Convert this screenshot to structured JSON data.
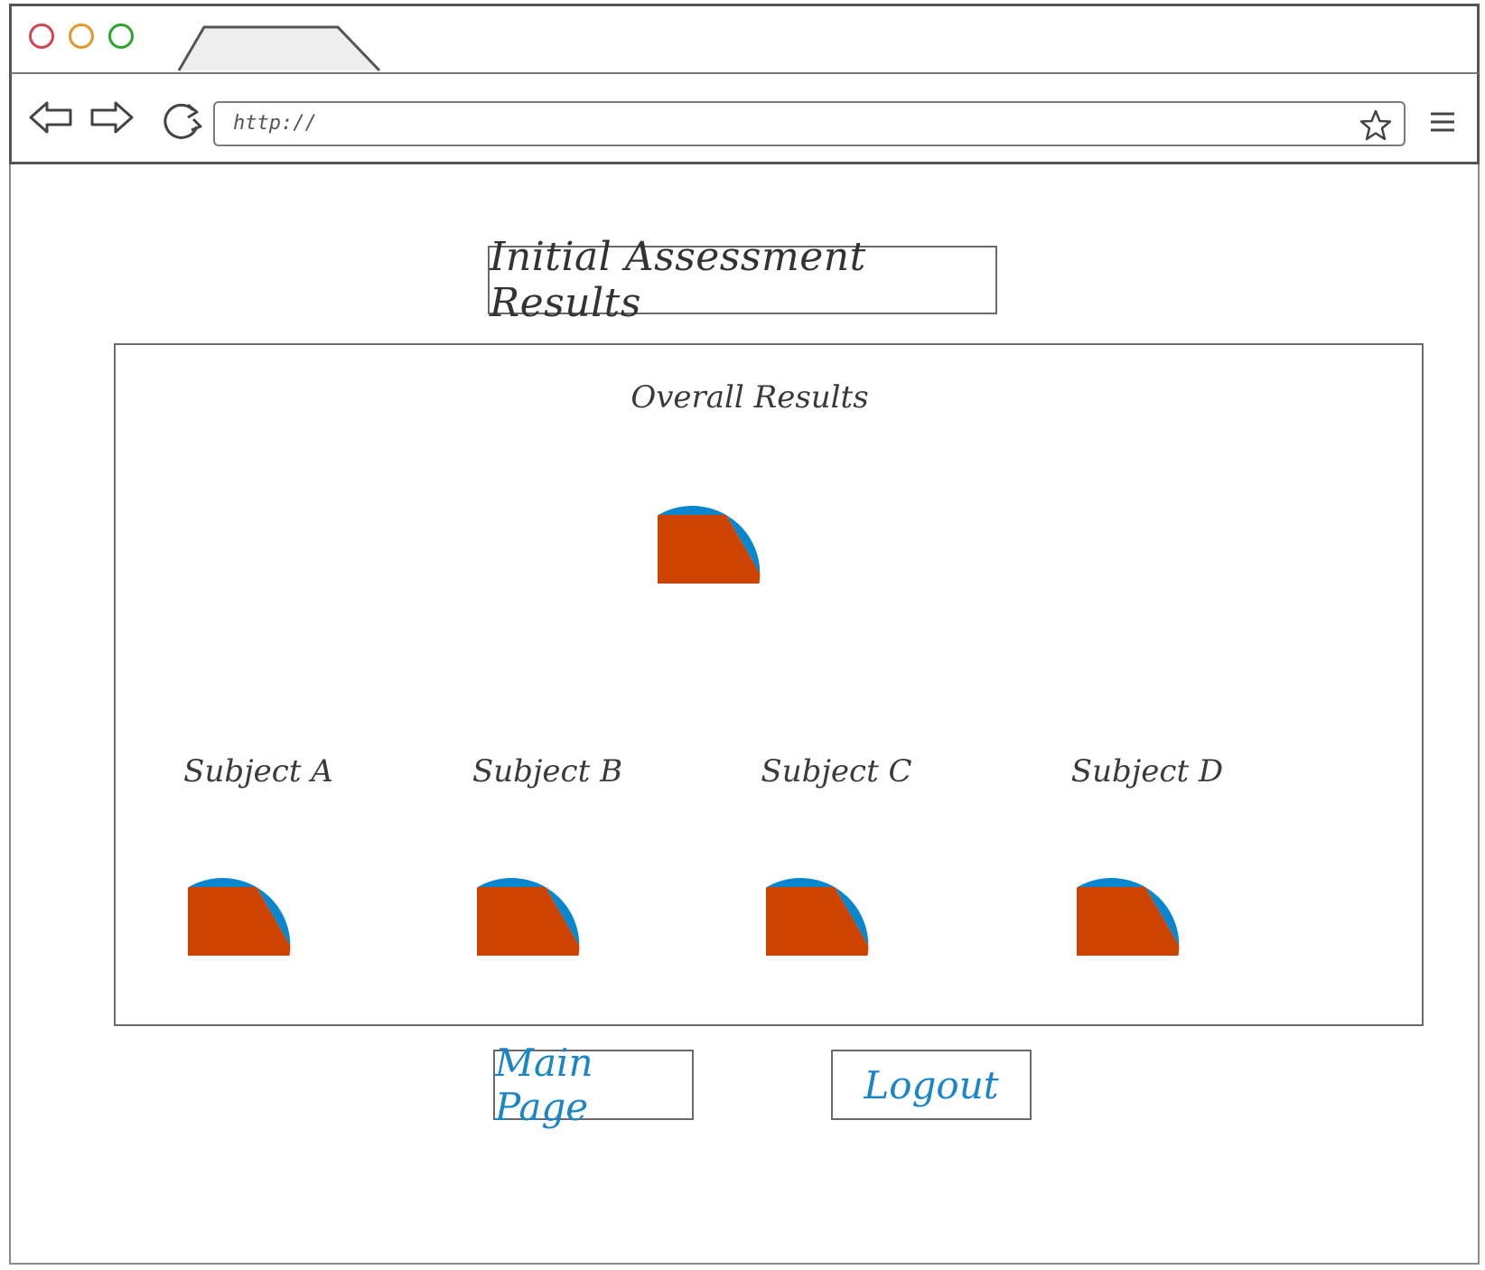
{
  "browser": {
    "url": "http://",
    "controls": {
      "close_color": "#d0454f",
      "minimize_color": "#e5962a",
      "maximize_color": "#2aa52a"
    }
  },
  "page": {
    "title": "Initial Assessment Results"
  },
  "chart_data": {
    "type": "pie",
    "colors": {
      "primary": "#cc4400",
      "secondary": "#0a86ce"
    },
    "charts": [
      {
        "id": "overall",
        "title": "Overall Results",
        "slices": [
          0.667,
          0.333
        ]
      },
      {
        "id": "subject-a",
        "title": "Subject A",
        "slices": [
          0.667,
          0.333
        ]
      },
      {
        "id": "subject-b",
        "title": "Subject B",
        "slices": [
          0.667,
          0.333
        ]
      },
      {
        "id": "subject-c",
        "title": "Subject C",
        "slices": [
          0.667,
          0.333
        ]
      },
      {
        "id": "subject-d",
        "title": "Subject D",
        "slices": [
          0.667,
          0.333
        ]
      }
    ]
  },
  "actions": {
    "main_page_label": "Main Page",
    "logout_label": "Logout"
  }
}
